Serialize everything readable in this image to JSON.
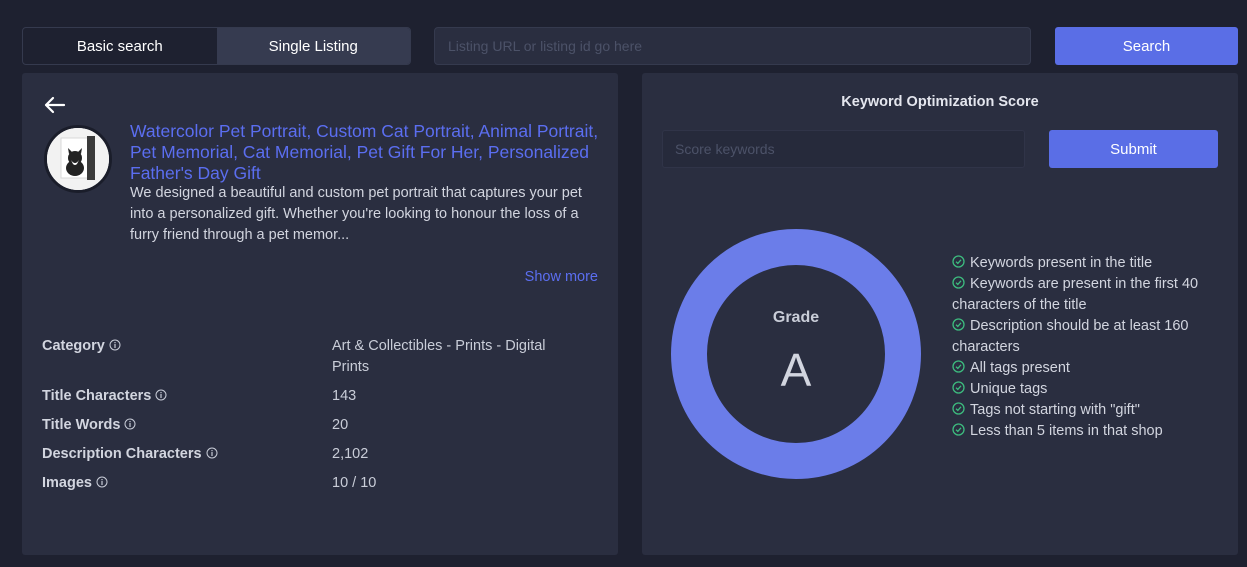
{
  "tabs": [
    {
      "label": "Basic search",
      "active": false
    },
    {
      "label": "Single Listing",
      "active": true
    }
  ],
  "search": {
    "placeholder": "Listing URL or listing id go here",
    "value": "",
    "button_label": "Search"
  },
  "listing": {
    "back_icon": "arrow-left-icon",
    "title": "Watercolor Pet Portrait, Custom Cat Portrait, Animal Portrait, Pet Memorial, Cat Memorial, Pet Gift For Her, Personalized Father's Day Gift",
    "description": "We designed a beautiful and custom pet portrait that captures your pet into a personalized gift. Whether you're looking to honour the loss of a furry friend through a pet memor...",
    "show_more_label": "Show more",
    "details": [
      {
        "label": "Category",
        "value": "Art & Collectibles - Prints - Digital Prints"
      },
      {
        "label": "Title Characters",
        "value": "143"
      },
      {
        "label": "Title Words",
        "value": "20"
      },
      {
        "label": "Description Characters",
        "value": "2,102"
      },
      {
        "label": "Images",
        "value": "10 / 10"
      }
    ]
  },
  "score": {
    "title": "Keyword Optimization Score",
    "input_placeholder": "Score keywords",
    "input_value": "",
    "submit_label": "Submit",
    "grade_label": "Grade",
    "grade_value": "A",
    "ring_fill": 1.0,
    "checks": [
      "Keywords present in the title",
      "Keywords are present in the first 40 characters of the title",
      "Description should be at least 160 characters",
      "All tags present",
      "Unique tags",
      "Tags not starting with \"gift\"",
      "Less than 5 items in that shop"
    ]
  },
  "colors": {
    "background": "#1e2130",
    "panel": "#2a2e40",
    "accent": "#5a6ee6",
    "link": "#5b6ef0",
    "ring": "#6b7de9",
    "check": "#3dbb7e"
  }
}
